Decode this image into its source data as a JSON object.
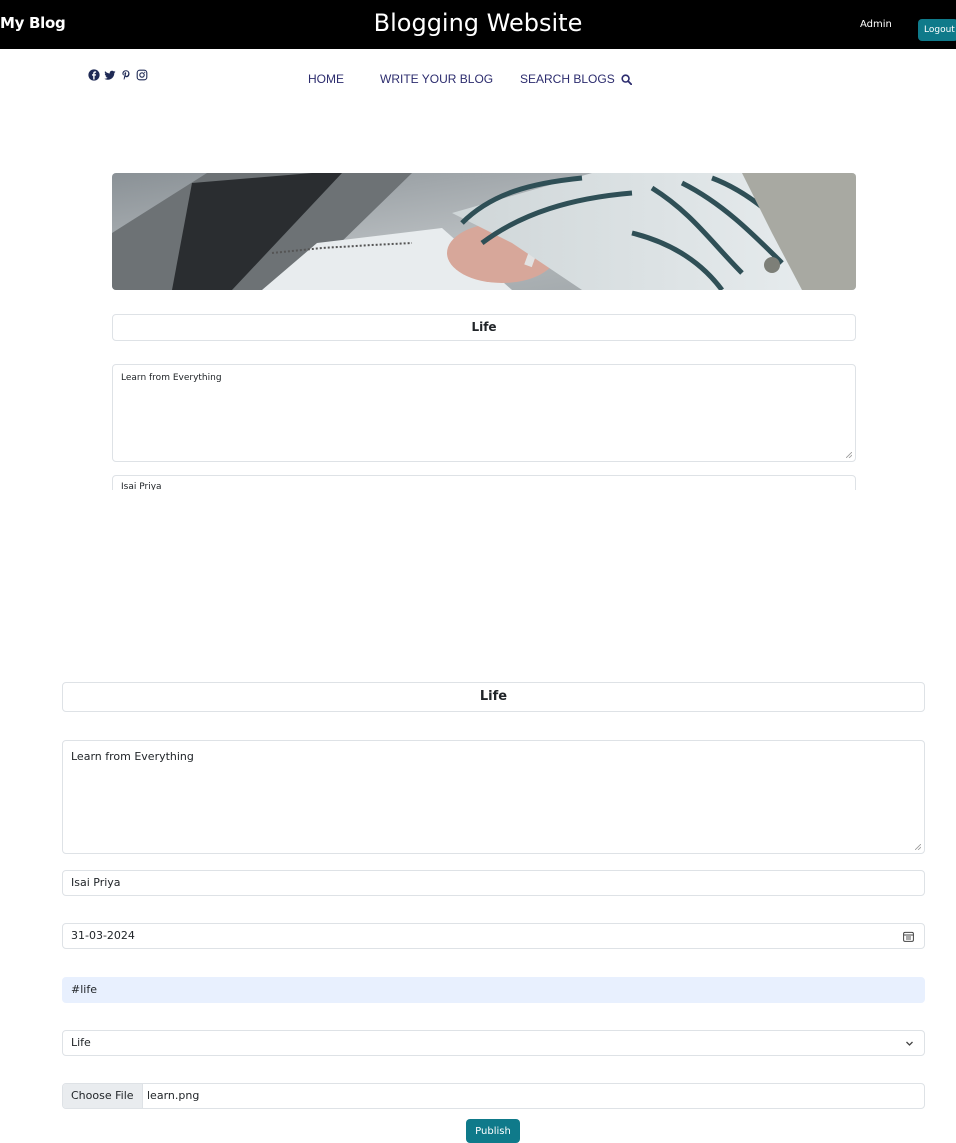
{
  "header": {
    "brand": "My Blog",
    "site_title": "Blogging Website",
    "user": "Admin",
    "logout_label": "Logout"
  },
  "nav": {
    "social_icons": [
      "facebook-icon",
      "twitter-icon",
      "pinterest-icon",
      "instagram-icon"
    ],
    "items": [
      {
        "label": "HOME"
      },
      {
        "label": "WRITE YOUR BLOG"
      },
      {
        "label": "SEARCH BLOGS"
      }
    ],
    "search_icon": "search-icon"
  },
  "preview_card": {
    "title": "Life",
    "content": "Learn from Everything",
    "author": "Isai Priya"
  },
  "blog_form": {
    "title": "Life",
    "content": "Learn from Everything",
    "author": "Isai Priya",
    "date": "31-03-2024",
    "tags": "#life",
    "category": "Life",
    "file_button": "Choose File",
    "file_name": "learn.png",
    "publish_label": "Publish"
  },
  "colors": {
    "header_bg": "#000000",
    "accent": "#0f7a8a",
    "nav_text": "#2c2c6e",
    "tag_field_bg": "#e8f0fe"
  }
}
